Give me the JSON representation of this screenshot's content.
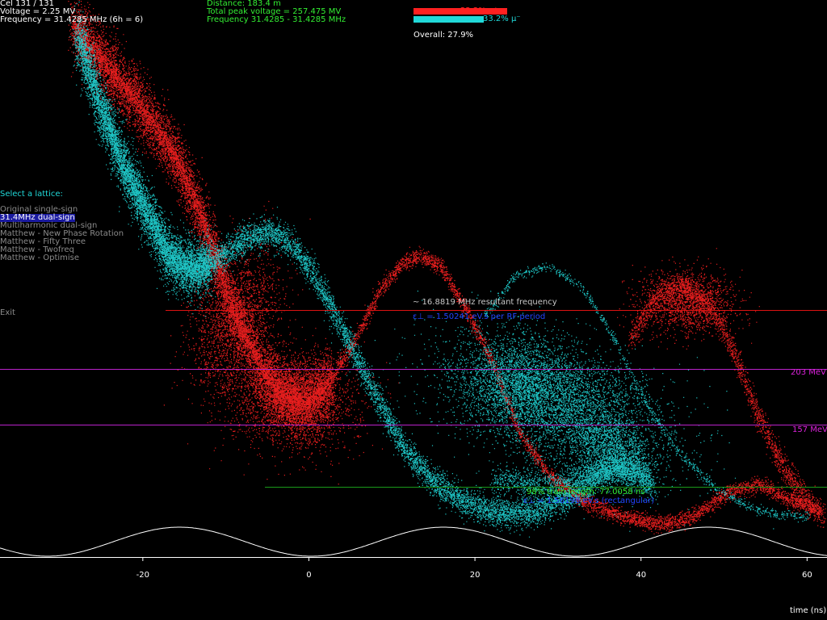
{
  "status": {
    "cell": "Cel 131 / 131",
    "voltage": "Voltage = 2.25 MV",
    "frequency": "Frequency = 31.4285 MHz  (6h = 6)",
    "distance": "Distance: 183.4 m",
    "total_peak": "Total peak voltage = 257.475 MV",
    "freq_range": "Frequency 31.4285 - 31.4285 MHz"
  },
  "efficiency": {
    "mu_plus_label": "22.2% μ⁺",
    "mu_plus_value": 22.2,
    "mu_minus_label": "33.2% μ⁻",
    "mu_minus_value": 33.2,
    "overall": "Overall: 27.9%"
  },
  "menu": {
    "heading": "Select a lattice:",
    "items": [
      {
        "label": "Original single-sign",
        "selected": false
      },
      {
        "label": "31.4MHz dual-sign",
        "selected": true
      },
      {
        "label": "Multiharmonic dual-sign",
        "selected": false
      },
      {
        "label": "Matthew - New Phase Rotation",
        "selected": false
      },
      {
        "label": "Matthew - Fifty Three",
        "selected": false
      },
      {
        "label": "Matthew - Twofreq",
        "selected": false
      },
      {
        "label": "Matthew - Optimise",
        "selected": false
      }
    ],
    "exit": "Exit"
  },
  "annotations": {
    "resultant": "~ 16.8819 MHz resultant frequency",
    "eps_period": "ε⊥ = 1.50241 eV.s per RF period",
    "train_length": "98% train length: 77.0058 ns",
    "eps_rect": "ε⊥ = 1.56198 eV.s (rectangular)",
    "mev203": "203 MeV",
    "mev157": "157 MeV"
  },
  "colors": {
    "mu_plus": "#ff2020",
    "mu_minus": "#20d8d8",
    "green": "#33ee33",
    "magenta": "#bb22cc",
    "blue": "#2244ff"
  },
  "chart_data": {
    "type": "scatter",
    "xlabel": "time (ns)",
    "xticks": [
      -20,
      0,
      20,
      40,
      60
    ],
    "xlim": [
      -37.2,
      62.4
    ],
    "rf_frequency_mhz": 31.4285,
    "series": [
      {
        "name": "μ⁺",
        "color": "#ff2020"
      },
      {
        "name": "μ⁻",
        "color": "#20d8d8"
      }
    ],
    "reference_lines": [
      {
        "label": "203 MeV"
      },
      {
        "label": "157 MeV"
      }
    ]
  }
}
